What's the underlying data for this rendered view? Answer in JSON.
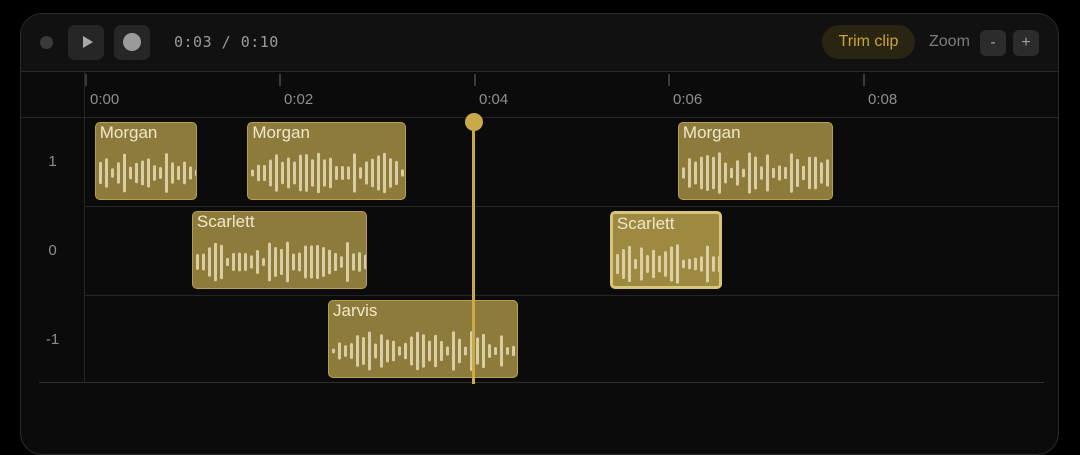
{
  "toolbar": {
    "time_display": "0:03 / 0:10",
    "trim_label": "Trim clip",
    "zoom_label": "Zoom",
    "zoom_out_label": "-",
    "zoom_in_label": "+"
  },
  "icons": {
    "record_indicator": "recording-status-icon",
    "play": "play-icon",
    "record": "record-icon"
  },
  "colors": {
    "accent": "#c9a94a",
    "clip_fill": "#8d7b3c",
    "clip_selected_fill": "#9e8941",
    "waveform": "#e8dcb4"
  },
  "ruler": {
    "ticks": [
      "0:00",
      "0:02",
      "0:04",
      "0:06",
      "0:08"
    ]
  },
  "tracks": [
    {
      "label": "1"
    },
    {
      "label": "0"
    },
    {
      "label": "-1"
    }
  ],
  "clips": [
    {
      "track": 0,
      "speaker": "Morgan",
      "start": 0.1,
      "end": 1.15,
      "selected": false
    },
    {
      "track": 0,
      "speaker": "Morgan",
      "start": 1.67,
      "end": 3.3,
      "selected": false
    },
    {
      "track": 0,
      "speaker": "Morgan",
      "start": 6.1,
      "end": 7.7,
      "selected": false
    },
    {
      "track": 1,
      "speaker": "Scarlett",
      "start": 1.1,
      "end": 2.9,
      "selected": false
    },
    {
      "track": 1,
      "speaker": "Scarlett",
      "start": 5.4,
      "end": 6.55,
      "selected": true
    },
    {
      "track": 2,
      "speaker": "Jarvis",
      "start": 2.5,
      "end": 4.45,
      "selected": false
    }
  ],
  "playhead_time": 4.0
}
